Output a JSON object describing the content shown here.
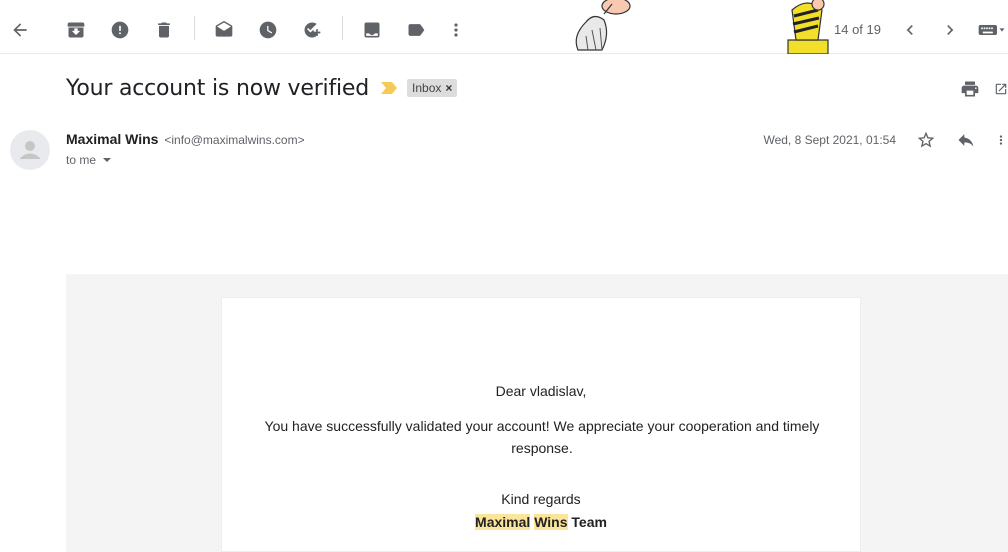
{
  "toolbar": {
    "icons": [
      "back-arrow-icon",
      "archive-icon",
      "report-spam-icon",
      "delete-icon",
      "mark-unread-icon",
      "snooze-icon",
      "add-task-icon",
      "move-to-icon",
      "labels-icon",
      "more-vert-icon"
    ],
    "pager": "14 of 19"
  },
  "email": {
    "subject": "Your account is now verified",
    "label": "Inbox",
    "label_close": "×",
    "sender_name": "Maximal Wins",
    "sender_email": "<info@maximalwins.com>",
    "to": "to me",
    "date": "Wed, 8 Sept 2021, 01:54"
  },
  "body": {
    "greeting": "Dear vladislav,",
    "message": "You have successfully validated your account! We appreciate your cooperation and timely response.",
    "regards": "Kind regards",
    "team_word1": "Maximal",
    "team_word2": "Wins",
    "team_word3": "Team"
  },
  "colors": {
    "icon": "#5f6368",
    "important_marker": "#f6ca57",
    "highlight": "#fbe59b",
    "mail_background": "#f4f4f4"
  }
}
